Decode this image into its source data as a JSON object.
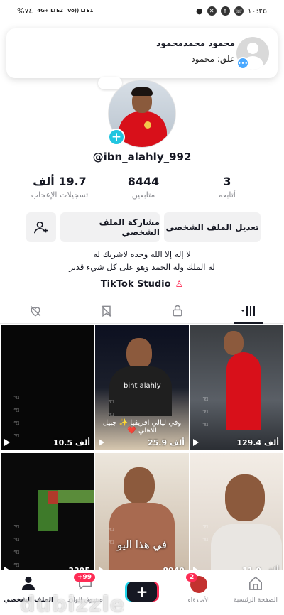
{
  "status_bar": {
    "time": "١٠:٢٥",
    "battery": "%٧٤",
    "net_left": "4G+ LTE2",
    "net_right": "Vo)) LTE1"
  },
  "notification": {
    "name": "محمود محمدمحمود",
    "message": "علق: محمود"
  },
  "profile": {
    "username": "@ibn_alahly_992",
    "stats": [
      {
        "value": "3",
        "label": "أتابعه"
      },
      {
        "value": "8444",
        "label": "متابعين"
      },
      {
        "value": "19.7 ألف",
        "label": "تسجيلات الإعجاب"
      }
    ],
    "edit_label": "تعديل الملف الشخصي",
    "share_label": "مشاركة الملف الشخصي",
    "bio_line1": "لا إله إلا الله وحده لاشريك له",
    "bio_line2": "له الملك وله الحمد وهو على كل شيء قدير",
    "studio_label": "TikTok Studio"
  },
  "tabs": [
    "videos",
    "private",
    "reposts",
    "liked"
  ],
  "videos": [
    {
      "views": "10.5 ألف"
    },
    {
      "views": "25.9 ألف",
      "caption": "وفي ليالي افريقيا ✨ جبيل للاهلي ❤️",
      "tag": "bint alahly"
    },
    {
      "views": "129.4 ألف"
    },
    {
      "views": "3395"
    },
    {
      "views": "8949",
      "caption": "في هذا اليو"
    },
    {
      "views": "11.9 ألف"
    }
  ],
  "bottom_nav": {
    "home": "الصفحة الرئيسية",
    "friends": "الأصدقاء",
    "friends_badge": "2",
    "inbox": "صندوق الوارد",
    "inbox_badge": "+99",
    "profile": "الملف الشخصي"
  },
  "watermark": "dubizzle"
}
